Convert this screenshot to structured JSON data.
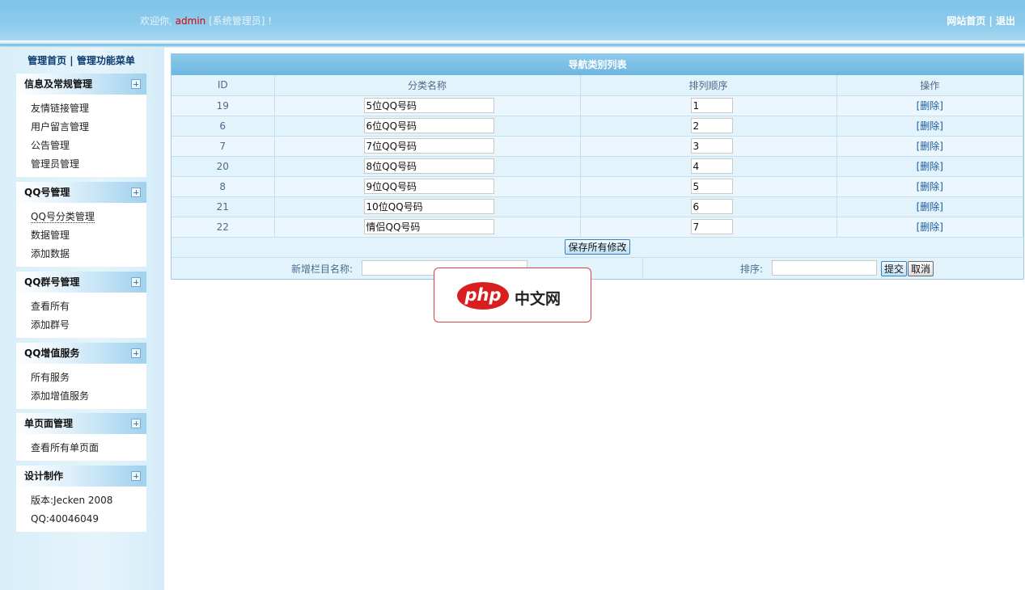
{
  "header": {
    "welcome_prefix": "欢迎你,",
    "username": "admin",
    "role": "[系统管理员]",
    "welcome_suffix": "!",
    "link_home": "网站首页",
    "separator": "|",
    "link_logout": "退出"
  },
  "sidebar": {
    "top_home": "管理首页",
    "top_separator": "|",
    "top_menu": "管理功能菜单",
    "panels": [
      {
        "title": "信息及常规管理",
        "items": [
          "友情链接管理",
          "用户留言管理",
          "公告管理",
          "管理员管理"
        ]
      },
      {
        "title": "QQ号管理",
        "items": [
          "QQ号分类管理",
          "数据管理",
          "添加数据"
        ]
      },
      {
        "title": "QQ群号管理",
        "items": [
          "查看所有",
          "添加群号"
        ]
      },
      {
        "title": "QQ增值服务",
        "items": [
          "所有服务",
          "添加增值服务"
        ]
      },
      {
        "title": "单页面管理",
        "items": [
          "查看所有单页面"
        ]
      },
      {
        "title": "设计制作",
        "items": [
          "版本:Jecken 2008",
          "QQ:40046049"
        ]
      }
    ]
  },
  "table": {
    "title": "导航类别列表",
    "headers": [
      "ID",
      "分类名称",
      "排列顺序",
      "操作"
    ],
    "rows": [
      {
        "id": "19",
        "name": "5位QQ号码",
        "order": "1",
        "action": "[删除]"
      },
      {
        "id": "6",
        "name": "6位QQ号码",
        "order": "2",
        "action": "[删除]"
      },
      {
        "id": "7",
        "name": "7位QQ号码",
        "order": "3",
        "action": "[删除]"
      },
      {
        "id": "20",
        "name": "8位QQ号码",
        "order": "4",
        "action": "[删除]"
      },
      {
        "id": "8",
        "name": "9位QQ号码",
        "order": "5",
        "action": "[删除]"
      },
      {
        "id": "21",
        "name": "10位QQ号码",
        "order": "6",
        "action": "[删除]"
      },
      {
        "id": "22",
        "name": "情侣QQ号码",
        "order": "7",
        "action": "[删除]"
      }
    ],
    "save_button": "保存所有修改",
    "add_name_label": "新增栏目名称:",
    "add_name_value": "",
    "add_order_label": "排序:",
    "add_order_value": "",
    "submit_button": "提交",
    "cancel_button": "取消"
  },
  "watermark": {
    "logo": "php",
    "text": "中文网"
  },
  "colors": {
    "header_bg": "#7ec3ea",
    "username": "#d90000",
    "table_title_bg": "#6db6e0",
    "watermark_red": "#d81e1e"
  }
}
